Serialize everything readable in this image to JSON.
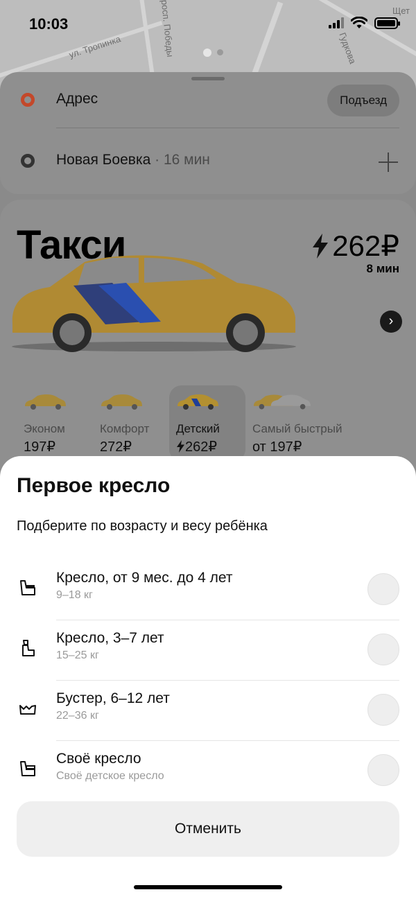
{
  "status_bar": {
    "time": "10:03"
  },
  "map": {
    "labels": [
      "ул. Тропинка",
      "просп. Победы",
      "Гудкова",
      "Щет"
    ]
  },
  "address": {
    "from_label": "Адрес",
    "entrance_button": "Подъезд",
    "to_label": "Новая Боевка",
    "to_eta": " · 16 мин"
  },
  "tariff": {
    "title": "Такси",
    "price": "262₽",
    "eta": "8 мин",
    "options": [
      {
        "name": "Эконом",
        "price": "197₽"
      },
      {
        "name": "Комфорт",
        "price": "272₽"
      },
      {
        "name": "Детский",
        "price": "262₽"
      },
      {
        "name": "Самый быстрый",
        "price": "от 197₽"
      }
    ]
  },
  "sheet": {
    "title": "Первое кресло",
    "subtitle": "Подберите по возрасту и весу ребёнка",
    "items": [
      {
        "title": "Кресло, от 9 мес. до 4 лет",
        "sub": "9–18 кг"
      },
      {
        "title": "Кресло, 3–7 лет",
        "sub": "15–25 кг"
      },
      {
        "title": "Бустер, 6–12 лет",
        "sub": "22–36 кг"
      },
      {
        "title": "Своё кресло",
        "sub": "Своё детское кресло"
      }
    ],
    "cancel": "Отменить"
  },
  "colors": {
    "taxi_yellow": "#d4a53a",
    "taxi_blue": "#2e5fd6",
    "pin_from": "#c4482a",
    "pin_to": "#333333"
  }
}
